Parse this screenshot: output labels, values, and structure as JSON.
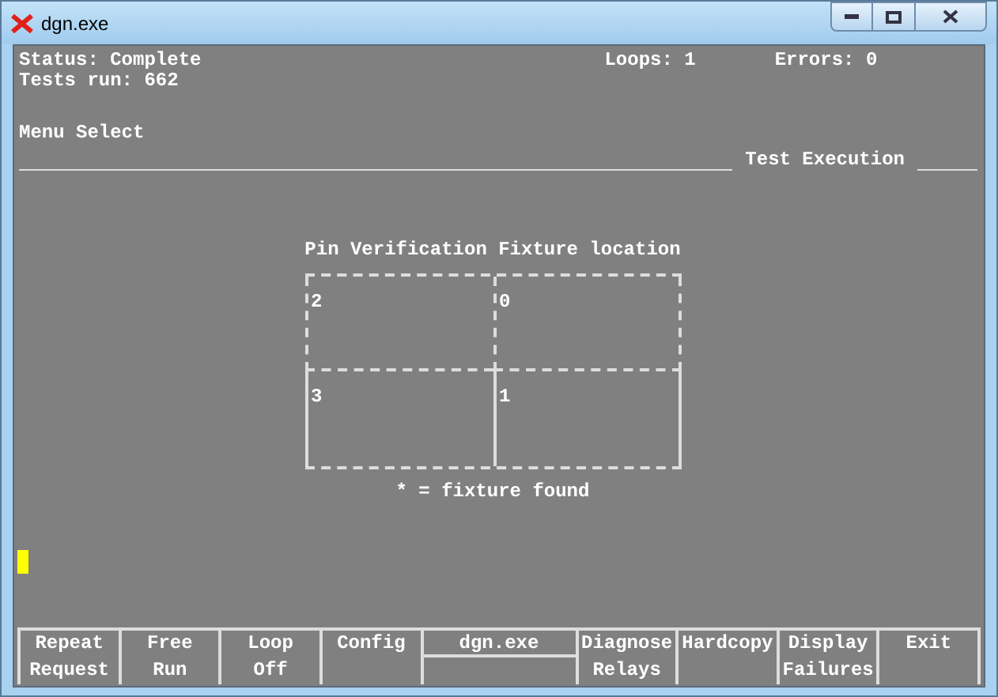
{
  "window": {
    "title": "dgn.exe"
  },
  "status": {
    "status": "Status: Complete",
    "tests_run": "Tests run: 662",
    "loops": "Loops: 1",
    "errors": "Errors: 0"
  },
  "menu": {
    "label": "Menu Select",
    "section": "Test Execution"
  },
  "fixture": {
    "title": "Pin Verification Fixture location",
    "cells": [
      "2",
      "0",
      "3",
      "1"
    ],
    "legend": "* = fixture found"
  },
  "function_keys": [
    {
      "kind": "plain",
      "lines": [
        "Repeat",
        "Request"
      ]
    },
    {
      "kind": "plain",
      "lines": [
        "Free",
        "Run"
      ]
    },
    {
      "kind": "plain",
      "lines": [
        "Loop",
        "Off"
      ]
    },
    {
      "kind": "plain",
      "lines": [
        "Config"
      ]
    },
    {
      "kind": "split",
      "lines": [
        "dgn.exe"
      ]
    },
    {
      "kind": "plain",
      "lines": [
        "Diagnose",
        "Relays"
      ]
    },
    {
      "kind": "plain",
      "lines": [
        "Hardcopy"
      ]
    },
    {
      "kind": "plain",
      "lines": [
        "Display",
        "Failures"
      ]
    },
    {
      "kind": "plain",
      "lines": [
        "Exit"
      ]
    }
  ]
}
